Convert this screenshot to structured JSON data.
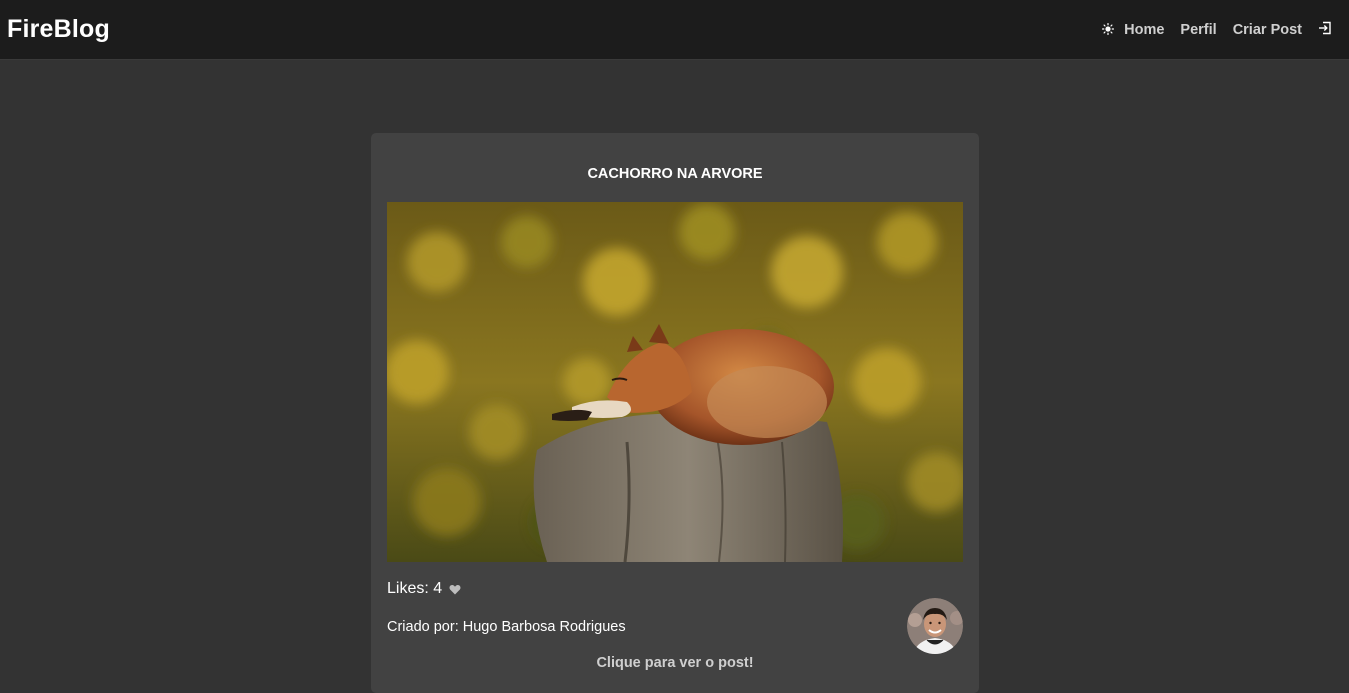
{
  "navbar": {
    "brand": "FireBlog",
    "theme_icon": "sun-icon",
    "links": [
      {
        "label": "Home"
      },
      {
        "label": "Perfil"
      },
      {
        "label": "Criar Post"
      }
    ],
    "login_icon": "sign-in-icon"
  },
  "post": {
    "title": "CACHORRO NA ARVORE",
    "likes_text": "Likes: 4",
    "like_icon": "heart-icon",
    "author_text": "Criado por: Hugo Barbosa Rodrigues",
    "cta": "Clique para ver o post!"
  },
  "colors": {
    "background": "#333333",
    "navbar": "#1c1c1c",
    "card": "#424242"
  }
}
